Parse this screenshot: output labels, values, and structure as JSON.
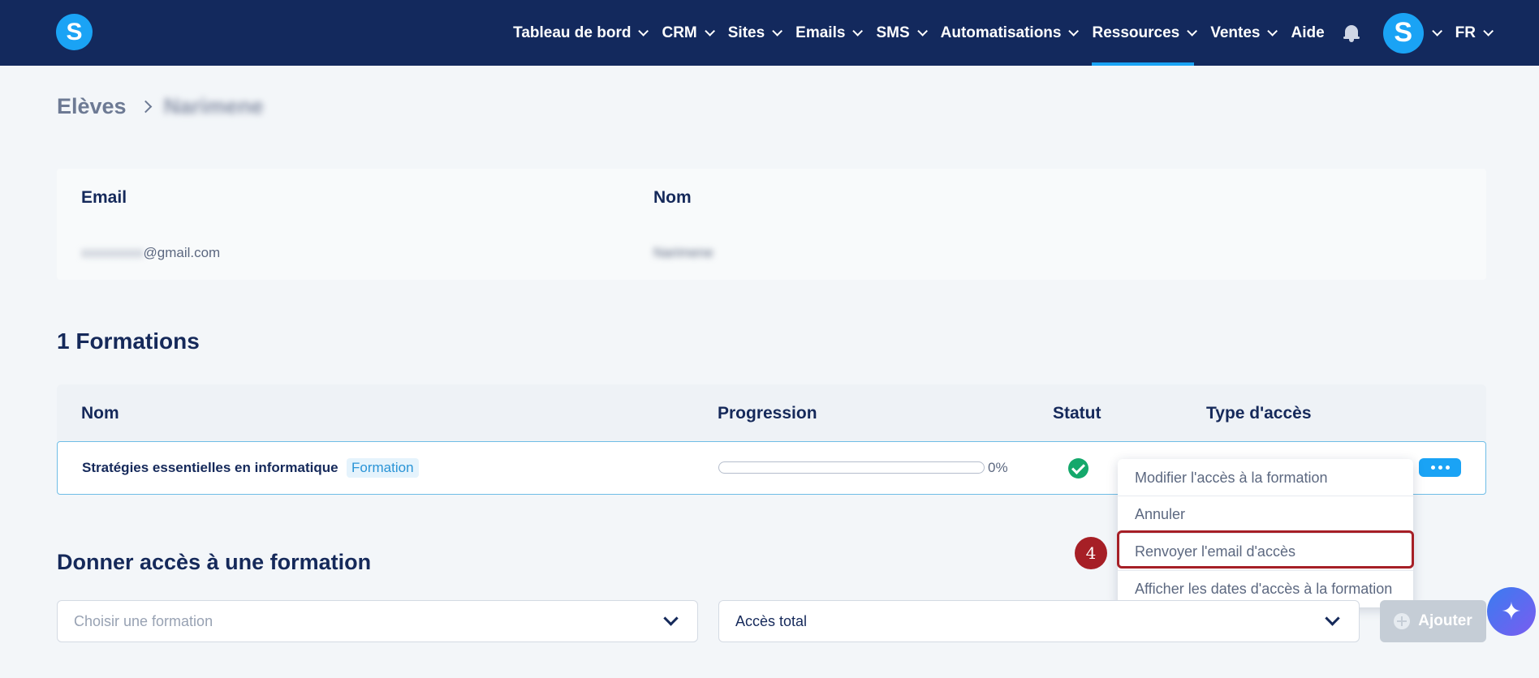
{
  "nav": {
    "items": [
      {
        "label": "Tableau de bord",
        "active": false
      },
      {
        "label": "CRM",
        "active": false
      },
      {
        "label": "Sites",
        "active": false
      },
      {
        "label": "Emails",
        "active": false
      },
      {
        "label": "SMS",
        "active": false
      },
      {
        "label": "Automatisations",
        "active": false
      },
      {
        "label": "Ressources",
        "active": true
      },
      {
        "label": "Ventes",
        "active": false
      }
    ],
    "help_label": "Aide",
    "logo_letter": "S",
    "avatar_letter": "S",
    "language": "FR",
    "icons": {
      "bell": "bell-icon"
    }
  },
  "breadcrumb": {
    "parent": "Elèves",
    "current": "Narimene"
  },
  "student": {
    "email_label": "Email",
    "email_masked": "xxxxxxxxx",
    "email_domain": "@gmail.com",
    "name_label": "Nom",
    "name_value": "Narimene"
  },
  "formations": {
    "title": "1 Formations",
    "columns": [
      "Nom",
      "Progression",
      "Statut",
      "Type d'accès"
    ],
    "rows": [
      {
        "name": "Stratégies essentielles en informatique",
        "badge": "Formation",
        "progress": 0,
        "progress_label": "0%",
        "status": "check-circle-icon"
      }
    ]
  },
  "menu": {
    "items": [
      "Modifier l'accès à la formation",
      "Annuler",
      "Renvoyer l'email d'accès",
      "Afficher les dates d'accès à la formation"
    ],
    "highlight_step": "4"
  },
  "give_access": {
    "title": "Donner accès à une formation",
    "formation_placeholder": "Choisir une formation",
    "access_value": "Accès total",
    "add_label": "Ajouter"
  },
  "colors": {
    "navbar": "#13295d",
    "accent": "#1aa3f5",
    "highlight": "#a61f26",
    "success": "#14a86b"
  }
}
